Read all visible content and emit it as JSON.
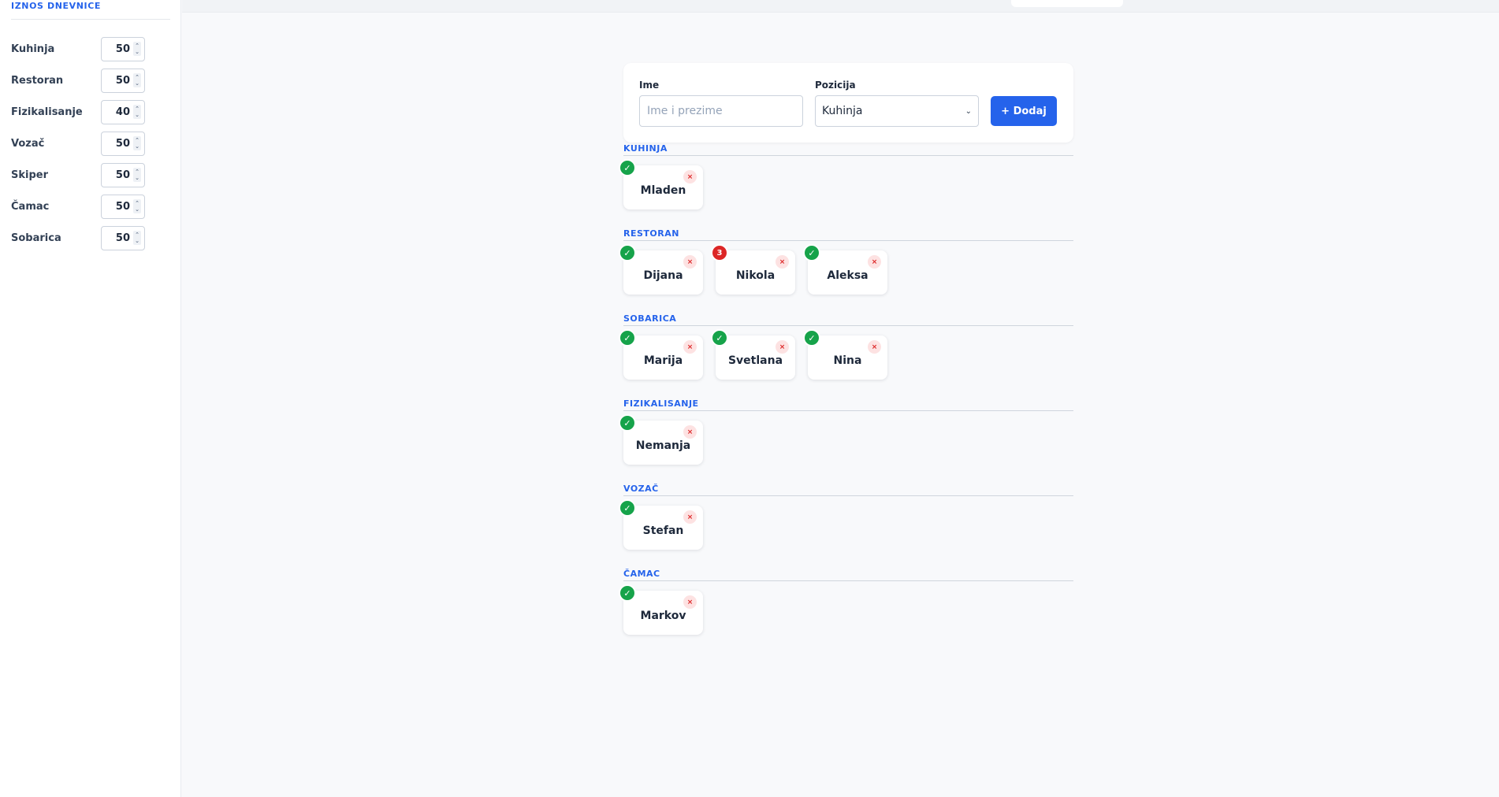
{
  "sidebar": {
    "title": "IZNOS DNEVNICE",
    "rates": [
      {
        "label": "Kuhinja",
        "value": "50"
      },
      {
        "label": "Restoran",
        "value": "50"
      },
      {
        "label": "Fizikalisanje",
        "value": "40"
      },
      {
        "label": "Vozač",
        "value": "50"
      },
      {
        "label": "Skiper",
        "value": "50"
      },
      {
        "label": "Čamac",
        "value": "50"
      },
      {
        "label": "Sobarica",
        "value": "50"
      }
    ]
  },
  "form": {
    "name_label": "Ime",
    "name_placeholder": "Ime i prezime",
    "name_value": "",
    "position_label": "Pozicija",
    "position_value": "Kuhinja",
    "add_label": "+ Dodaj"
  },
  "icons": {
    "check": "✓",
    "remove": "×",
    "spin_up": "⌃",
    "spin_down": "⌄",
    "chevron": "⌄"
  },
  "colors": {
    "accent": "#2563eb",
    "ok": "#16a34a",
    "warn": "#dc2626"
  },
  "groups": [
    {
      "title": "KUHINJA",
      "people": [
        {
          "name": "Mladen",
          "badge": "✓",
          "status": "ok"
        }
      ]
    },
    {
      "title": "RESTORAN",
      "people": [
        {
          "name": "Dijana",
          "badge": "✓",
          "status": "ok"
        },
        {
          "name": "Nikola",
          "badge": "3",
          "status": "warn"
        },
        {
          "name": "Aleksa",
          "badge": "✓",
          "status": "ok"
        }
      ]
    },
    {
      "title": "SOBARICA",
      "people": [
        {
          "name": "Marija",
          "badge": "✓",
          "status": "ok"
        },
        {
          "name": "Svetlana",
          "badge": "✓",
          "status": "ok"
        },
        {
          "name": "Nina",
          "badge": "✓",
          "status": "ok"
        }
      ]
    },
    {
      "title": "FIZIKALISANJE",
      "people": [
        {
          "name": "Nemanja",
          "badge": "✓",
          "status": "ok"
        }
      ]
    },
    {
      "title": "VOZAČ",
      "people": [
        {
          "name": "Stefan",
          "badge": "✓",
          "status": "ok"
        }
      ]
    },
    {
      "title": "ČAMAC",
      "people": [
        {
          "name": "Markov",
          "badge": "✓",
          "status": "ok"
        }
      ]
    }
  ]
}
